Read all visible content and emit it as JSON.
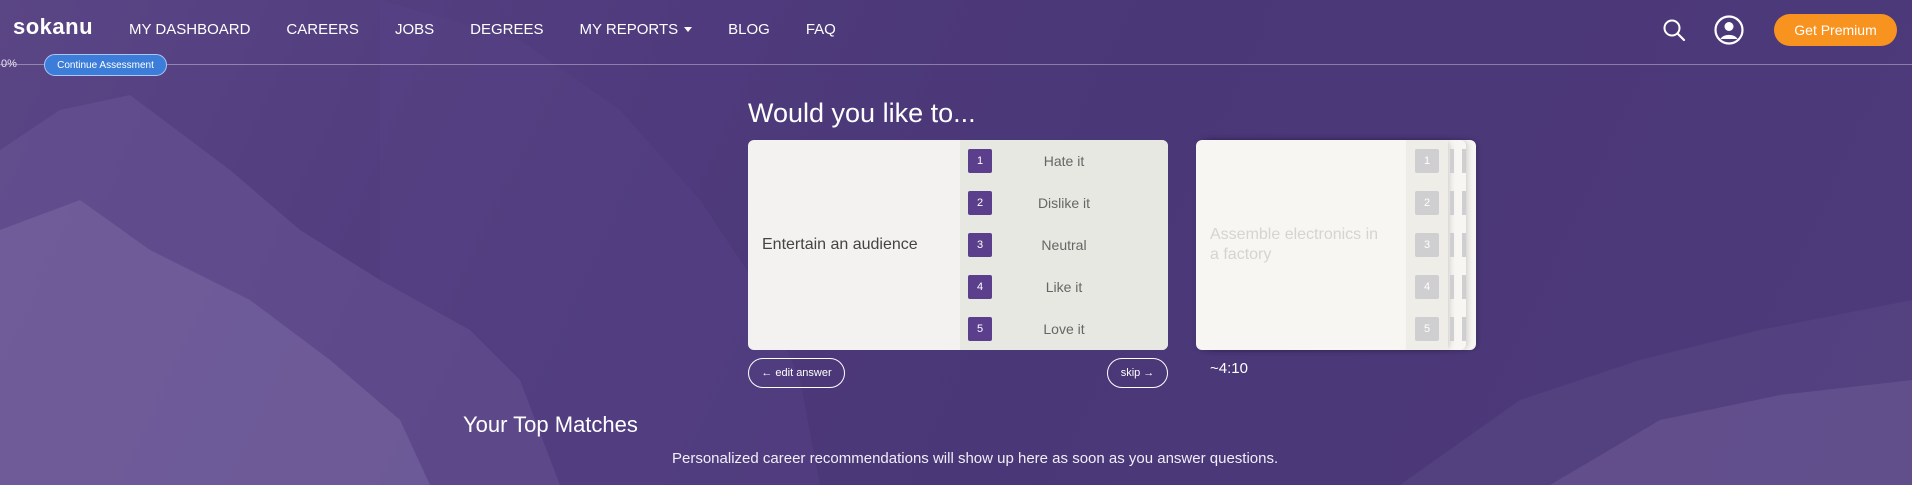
{
  "brand": {
    "logo": "sokanu"
  },
  "nav": {
    "items": [
      {
        "label": "MY DASHBOARD"
      },
      {
        "label": "CAREERS"
      },
      {
        "label": "JOBS"
      },
      {
        "label": "DEGREES"
      },
      {
        "label": "MY REPORTS",
        "dropdown": true
      },
      {
        "label": "BLOG"
      },
      {
        "label": "FAQ"
      }
    ],
    "premium_label": "Get Premium",
    "icons": {
      "search": "search-icon",
      "profile": "profile-icon"
    }
  },
  "progress": {
    "percent_text": "0%",
    "value": 0,
    "continue_label": "Continue Assessment"
  },
  "question": {
    "title": "Would you like to...",
    "activity": "Entertain an audience",
    "options": [
      {
        "num": "1",
        "label": "Hate it"
      },
      {
        "num": "2",
        "label": "Dislike it"
      },
      {
        "num": "3",
        "label": "Neutral"
      },
      {
        "num": "4",
        "label": "Like it"
      },
      {
        "num": "5",
        "label": "Love it"
      }
    ],
    "edit_label": "← edit answer",
    "skip_label": "skip →"
  },
  "next_question": {
    "activity": "Assemble electronics in a factory",
    "nums": [
      "1",
      "2",
      "3",
      "4",
      "5"
    ]
  },
  "timer": "~4:10",
  "matches": {
    "title": "Your Top Matches",
    "text": "Personalized career recommendations will show up here as soon as you answer questions."
  },
  "colors": {
    "accent": "#f7931e",
    "brand_purple": "#5b3f8c",
    "continue_blue": "#3b7dd8"
  }
}
